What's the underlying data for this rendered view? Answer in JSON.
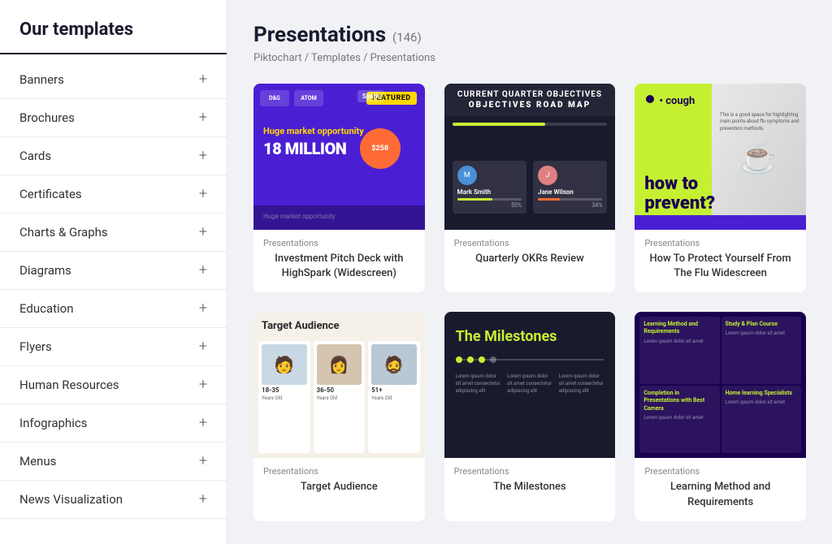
{
  "sidebar": {
    "title": "Our templates",
    "items": [
      {
        "label": "Banners",
        "id": "banners"
      },
      {
        "label": "Brochures",
        "id": "brochures"
      },
      {
        "label": "Cards",
        "id": "cards"
      },
      {
        "label": "Certificates",
        "id": "certificates"
      },
      {
        "label": "Charts & Graphs",
        "id": "charts-graphs"
      },
      {
        "label": "Diagrams",
        "id": "diagrams"
      },
      {
        "label": "Education",
        "id": "education"
      },
      {
        "label": "Flyers",
        "id": "flyers"
      },
      {
        "label": "Human Resources",
        "id": "human-resources"
      },
      {
        "label": "Infographics",
        "id": "infographics"
      },
      {
        "label": "Menus",
        "id": "menus"
      },
      {
        "label": "News Visualization",
        "id": "news-visualization"
      }
    ],
    "add_icon": "+"
  },
  "main": {
    "title": "Presentations",
    "count": "(146)",
    "breadcrumb": "Piktochart / Templates / Presentations",
    "templates": [
      {
        "id": "investment-pitch",
        "category": "Presentations",
        "name": "Investment Pitch Deck with HighSpark (Widescreen)",
        "featured": "FEATURED"
      },
      {
        "id": "quarterly-okrs",
        "category": "Presentations",
        "name": "Quarterly OKRs Review"
      },
      {
        "id": "flu-widescreen",
        "category": "Presentations",
        "name": "How To Protect Yourself From The Flu Widescreen"
      },
      {
        "id": "target-audience",
        "category": "Presentations",
        "name": "Target Audience"
      },
      {
        "id": "milestones",
        "category": "Presentations",
        "name": "The Milestones"
      },
      {
        "id": "learning-requirements",
        "category": "Presentations",
        "name": "Learning Method and Requirements"
      }
    ]
  }
}
